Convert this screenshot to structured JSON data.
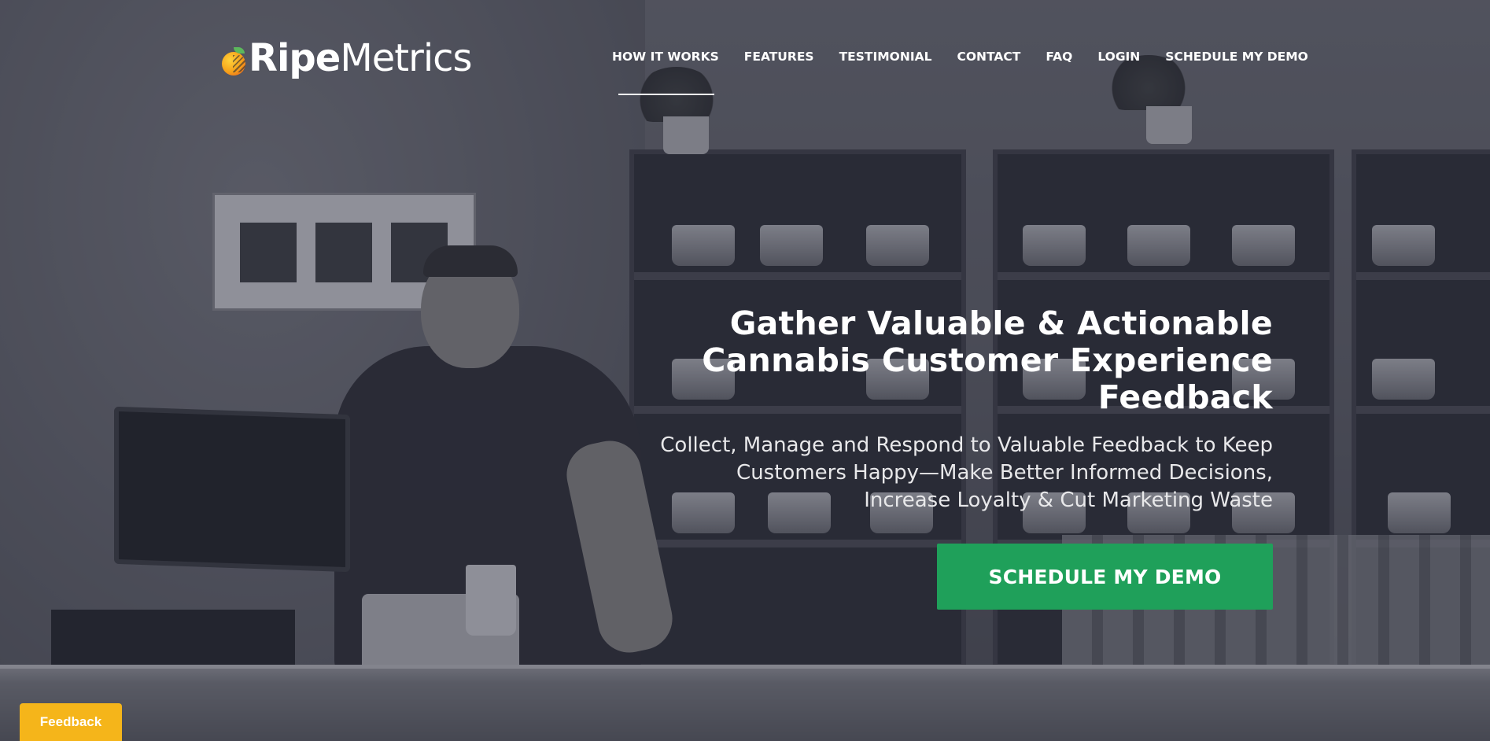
{
  "brand": {
    "logo_bold": "Ripe",
    "logo_light": "Metrics",
    "logo_icon": "ripe-fruit-logo-icon"
  },
  "nav": {
    "items": [
      {
        "label": "HOW IT WORKS",
        "active": true
      },
      {
        "label": "FEATURES",
        "active": false
      },
      {
        "label": "TESTIMONIAL",
        "active": false
      },
      {
        "label": "CONTACT",
        "active": false
      },
      {
        "label": "FAQ",
        "active": false
      },
      {
        "label": "LOGIN",
        "active": false
      },
      {
        "label": "SCHEDULE MY DEMO",
        "active": false
      }
    ]
  },
  "hero": {
    "headline_lines": [
      "Gather Valuable & Actionable",
      "Cannabis Customer Experience",
      "Feedback"
    ],
    "subhead_lines": [
      "Collect, Manage and Respond to Valuable Feedback to Keep",
      "Customers Happy—Make Better Informed Decisions,",
      "Increase Loyalty & Cut Marketing Waste"
    ],
    "cta_label": "SCHEDULE MY DEMO"
  },
  "feedback_tab": {
    "label": "Feedback"
  },
  "colors": {
    "cta_green": "#1fa05a",
    "feedback_yellow": "#f5b51a",
    "text_white": "#ffffff",
    "overlay_tint": "#282a3c"
  }
}
